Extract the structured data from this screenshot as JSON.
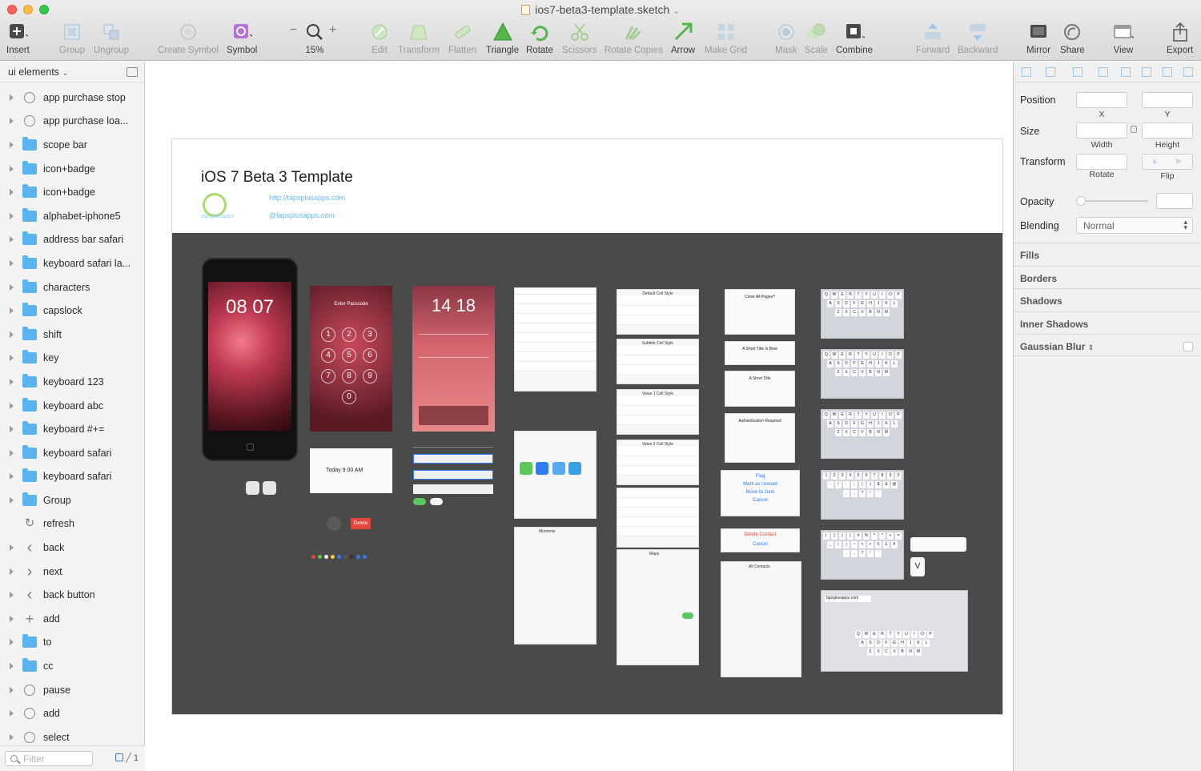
{
  "window": {
    "title": "ios7-beta3-template.sketch"
  },
  "toolbar": {
    "items": [
      {
        "label": "Insert",
        "icon": "plus-icon"
      },
      {
        "label": "Group",
        "icon": "group-icon"
      },
      {
        "label": "Ungroup",
        "icon": "ungroup-icon"
      },
      {
        "label": "Create Symbol",
        "icon": "create-symbol-icon"
      },
      {
        "label": "Symbol",
        "icon": "symbol-icon"
      },
      {
        "label": "15%",
        "icon": "zoom-icon"
      },
      {
        "label": "Edit",
        "icon": "edit-icon"
      },
      {
        "label": "Transform",
        "icon": "transform-icon"
      },
      {
        "label": "Flatten",
        "icon": "flatten-icon"
      },
      {
        "label": "Triangle",
        "icon": "triangle-icon"
      },
      {
        "label": "Rotate",
        "icon": "rotate-icon"
      },
      {
        "label": "Scissors",
        "icon": "scissors-icon"
      },
      {
        "label": "Rotate Copies",
        "icon": "rotate-copies-icon"
      },
      {
        "label": "Arrow",
        "icon": "arrow-icon"
      },
      {
        "label": "Make Grid",
        "icon": "grid-icon"
      },
      {
        "label": "Mask",
        "icon": "mask-icon"
      },
      {
        "label": "Scale",
        "icon": "scale-icon"
      },
      {
        "label": "Combine",
        "icon": "combine-icon"
      },
      {
        "label": "Forward",
        "icon": "forward-icon"
      },
      {
        "label": "Backward",
        "icon": "backward-icon"
      },
      {
        "label": "Mirror",
        "icon": "mirror-icon"
      },
      {
        "label": "Share",
        "icon": "share-icon"
      },
      {
        "label": "View",
        "icon": "view-icon"
      },
      {
        "label": "Export",
        "icon": "export-icon"
      }
    ],
    "zoom_minus": "−",
    "zoom_plus": "+"
  },
  "sidebar": {
    "page_name": "ui elements",
    "layers": [
      {
        "name": "app purchase stop",
        "icon": "symbol-circle-icon"
      },
      {
        "name": "app purchase loa...",
        "icon": "symbol-circle-icon"
      },
      {
        "name": "scope bar",
        "icon": "folder-icon"
      },
      {
        "name": "icon+badge",
        "icon": "folder-icon"
      },
      {
        "name": "icon+badge",
        "icon": "folder-icon"
      },
      {
        "name": "alphabet-iphone5",
        "icon": "folder-icon"
      },
      {
        "name": "address bar safari",
        "icon": "folder-icon"
      },
      {
        "name": "keyboard safari la...",
        "icon": "folder-icon"
      },
      {
        "name": "characters",
        "icon": "folder-icon"
      },
      {
        "name": "capslock",
        "icon": "folder-icon"
      },
      {
        "name": "shift",
        "icon": "folder-icon"
      },
      {
        "name": "key",
        "icon": "folder-icon"
      },
      {
        "name": "keyboard 123",
        "icon": "folder-icon"
      },
      {
        "name": "keyboard abc",
        "icon": "folder-icon"
      },
      {
        "name": "keyboard #+=",
        "icon": "folder-icon"
      },
      {
        "name": "keyboard safari",
        "icon": "folder-icon"
      },
      {
        "name": "keyboard safari",
        "icon": "folder-icon"
      },
      {
        "name": "Group",
        "icon": "folder-icon"
      },
      {
        "name": "refresh",
        "icon": "refresh-icon"
      },
      {
        "name": "back",
        "icon": "chevron-left-icon"
      },
      {
        "name": "next",
        "icon": "chevron-right-icon"
      },
      {
        "name": "back button",
        "icon": "back-button-icon"
      },
      {
        "name": "add",
        "icon": "plus-icon"
      },
      {
        "name": "to",
        "icon": "folder-icon"
      },
      {
        "name": "cc",
        "icon": "folder-icon"
      },
      {
        "name": "pause",
        "icon": "pause-icon"
      },
      {
        "name": "add",
        "icon": "add-circle-icon"
      },
      {
        "name": "select",
        "icon": "symbol-circle-icon"
      }
    ],
    "filter_placeholder": "Filter",
    "footer_count": "1"
  },
  "canvas": {
    "artboard_title": "iOS 7 Beta 3 Template",
    "link_site": "http://tapsplusapps.com",
    "link_twitter": "@tapsplusapps.com",
    "logo_text": "tapsplusapps",
    "lock_time": "08 07",
    "cc_time": "14 18",
    "passcode_header": "Enter Passcode",
    "keypad": [
      "1",
      "2",
      "3",
      "4",
      "5",
      "6",
      "7",
      "8",
      "9",
      "0"
    ],
    "picker_row": "Today   9   00   AM",
    "delete_label": "Delete",
    "cancel_label": "Cancel",
    "flag_label": "Flag",
    "mark_unread_label": "Mark as Unread",
    "move_junk_label": "Move to Junk",
    "delete_contact_label": "Delete Contact",
    "default_cell_style": "Default Cell Style",
    "subtitle_cell_style": "Subtitle Cell Style",
    "value1_cell_style": "Value 1 Cell Style",
    "value2_cell_style": "Value 2 Cell Style",
    "close_all_pages": "Close All Pages?",
    "short_title_best": "A Short Title Is Best",
    "short_title": "A Short Title",
    "auth_required": "Authentication Required",
    "all_contacts": "All Contacts",
    "maps_label": "Maps",
    "moments_label": "Moments",
    "address_text": "tapsplusapps.com"
  },
  "inspector": {
    "position_label": "Position",
    "x_label": "X",
    "y_label": "Y",
    "size_label": "Size",
    "width_label": "Width",
    "height_label": "Height",
    "transform_label": "Transform",
    "rotate_label": "Rotate",
    "flip_label": "Flip",
    "opacity_label": "Opacity",
    "blending_label": "Blending",
    "blending_value": "Normal",
    "sections": [
      "Fills",
      "Borders",
      "Shadows",
      "Inner Shadows",
      "Gaussian Blur"
    ]
  },
  "colors": {
    "folder": "#5ab5ee",
    "canvas_dark": "#4a4a4a",
    "accent_blue": "#2e7cf6",
    "delete_red": "#e5463c"
  }
}
